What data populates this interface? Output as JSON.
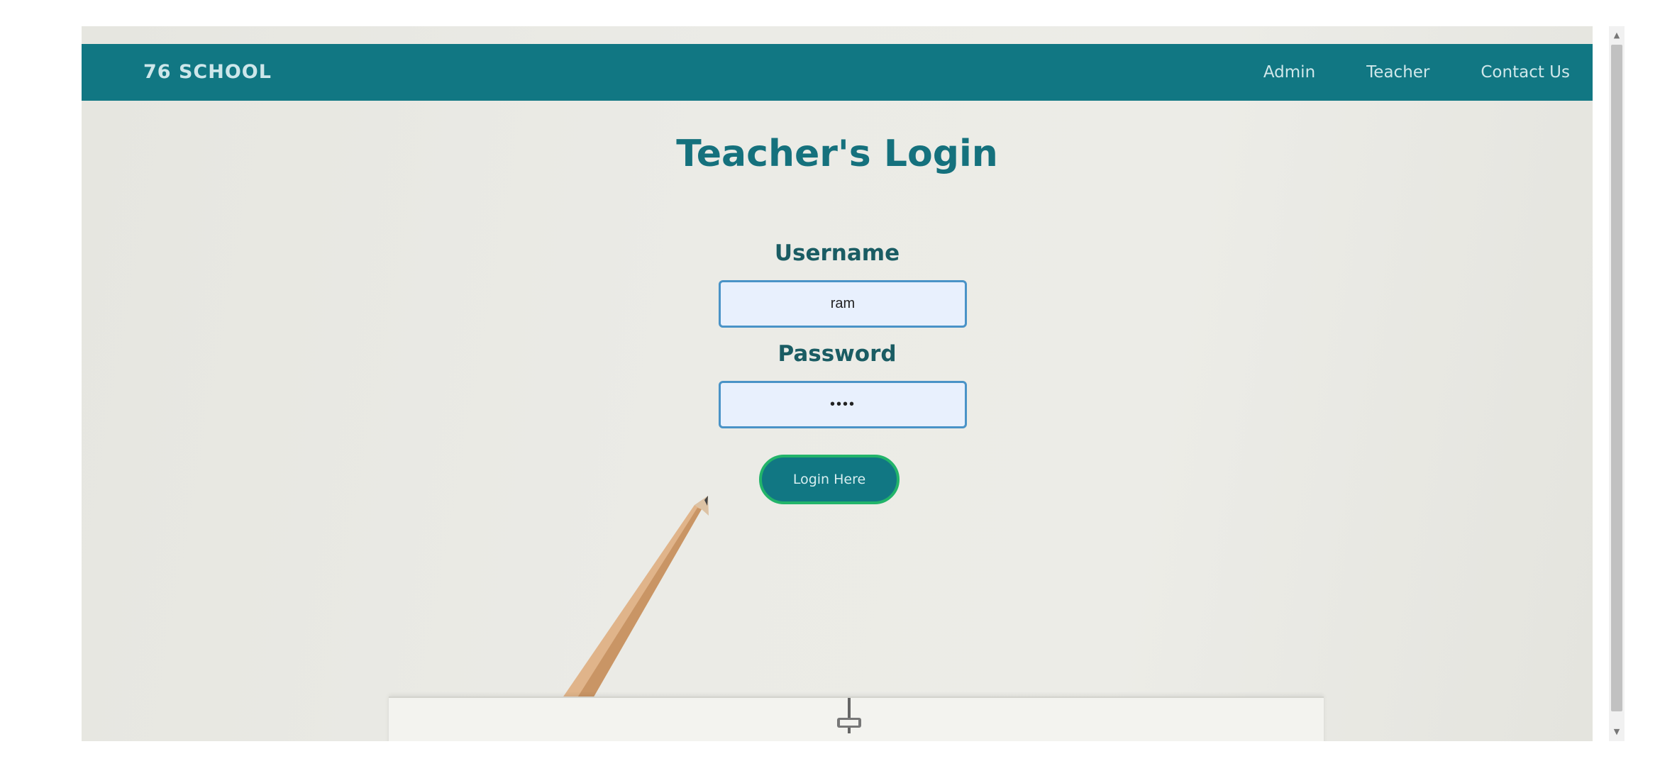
{
  "navbar": {
    "brand": "76 SCHOOL",
    "links": [
      {
        "label": "Admin"
      },
      {
        "label": "Teacher"
      },
      {
        "label": "Contact Us"
      }
    ]
  },
  "login": {
    "title": "Teacher's Login",
    "username_label": "Username",
    "username_value": "ram",
    "password_label": "Password",
    "password_value": "••••",
    "button_label": "Login Here"
  },
  "colors": {
    "navbar_bg": "#117783",
    "title_color": "#15717d",
    "label_color": "#1a5c63",
    "input_border": "#4a93c7",
    "input_bg": "#e8f0fd",
    "button_border": "#22b46a"
  },
  "icons": {
    "scroll_up": "scroll-up-arrow-icon",
    "scroll_down": "scroll-down-arrow-icon"
  }
}
